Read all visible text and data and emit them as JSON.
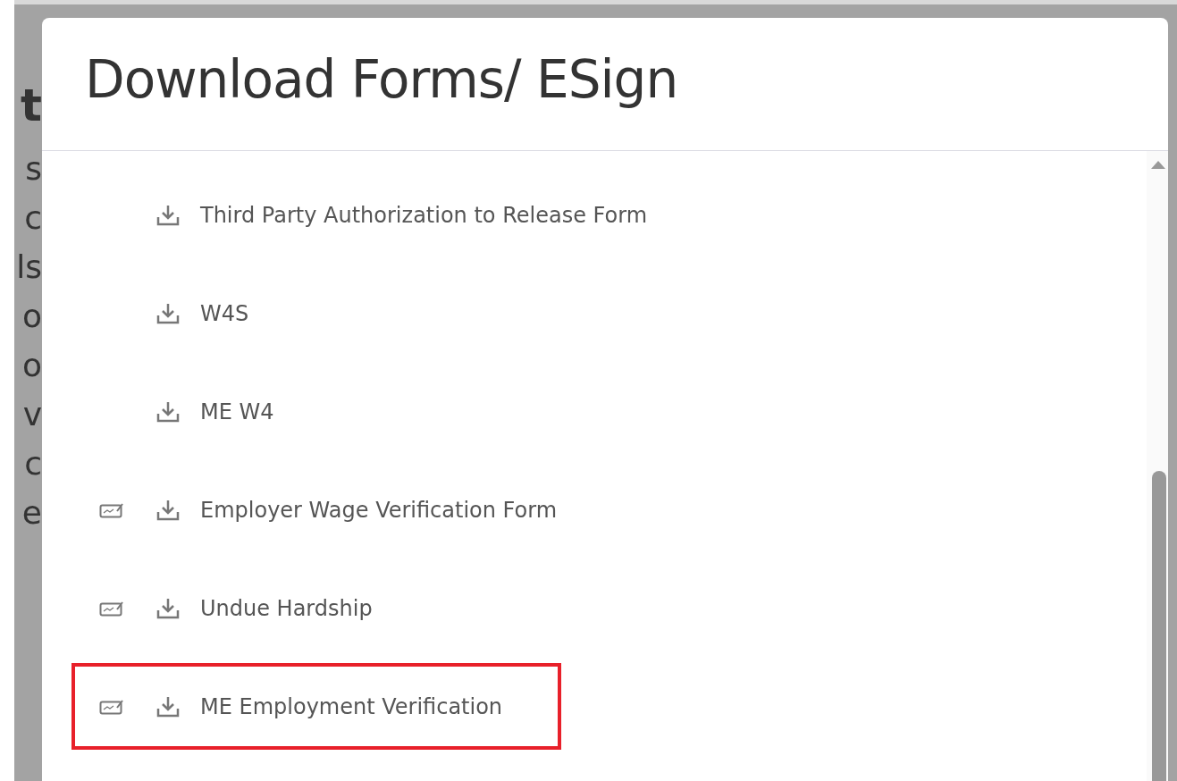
{
  "background": {
    "heading": "t",
    "lines": [
      "s",
      "c",
      "ls",
      "o",
      "o",
      "v",
      "c",
      "e"
    ]
  },
  "dialog": {
    "title": "Download Forms/ ESign",
    "forms": [
      {
        "label": "Third Party Authorization to Release Form",
        "esign": false,
        "highlighted": false
      },
      {
        "label": "W4S",
        "esign": false,
        "highlighted": false
      },
      {
        "label": "ME W4",
        "esign": false,
        "highlighted": false
      },
      {
        "label": "Employer Wage Verification Form",
        "esign": true,
        "highlighted": false
      },
      {
        "label": "Undue Hardship",
        "esign": true,
        "highlighted": false
      },
      {
        "label": "ME Employment Verification",
        "esign": true,
        "highlighted": true
      }
    ]
  }
}
